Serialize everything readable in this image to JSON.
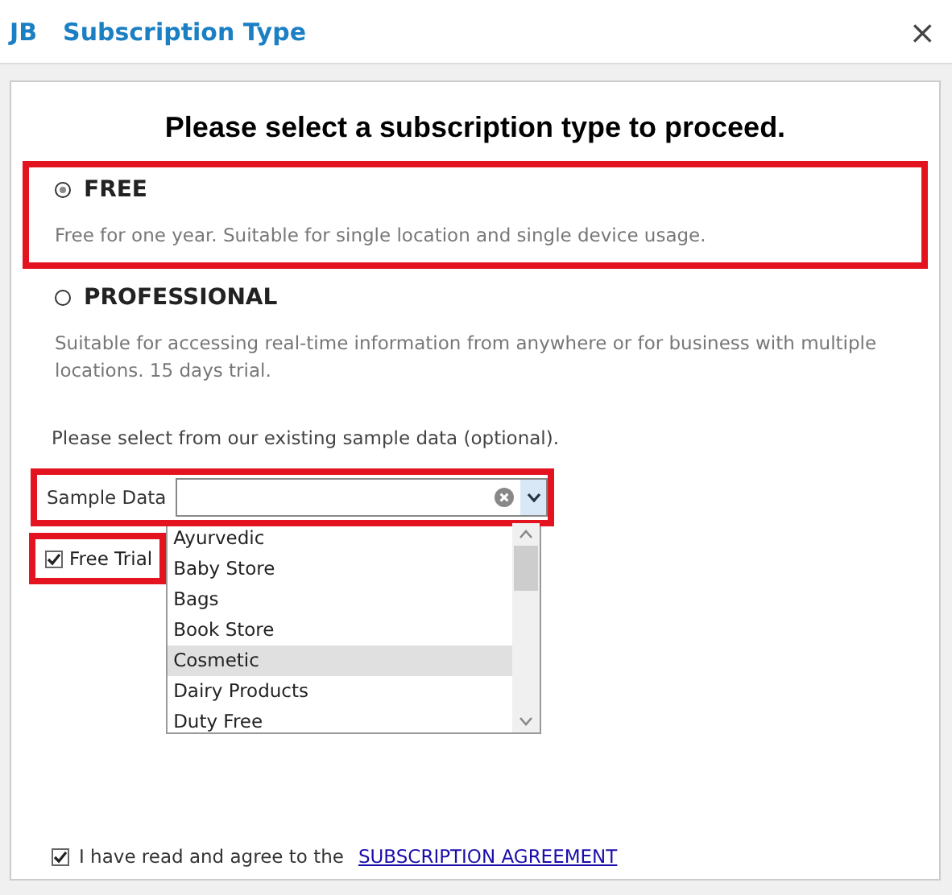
{
  "window": {
    "logo": "JB",
    "title": "Subscription Type",
    "close": "×"
  },
  "heading": "Please select a subscription type to proceed.",
  "plans": [
    {
      "name": "FREE",
      "description": "Free for one year. Suitable for single location and single device usage.",
      "selected": true,
      "highlighted": true
    },
    {
      "name": "PROFESSIONAL",
      "description": "Suitable for accessing real-time information from anywhere or for business with multiple locations. 15 days trial.",
      "selected": false,
      "highlighted": false
    }
  ],
  "sample_prompt": "Please select from our existing sample data (optional).",
  "sample_data": {
    "label": "Sample Data",
    "highlighted": true,
    "expanded": true,
    "options": [
      {
        "label": "Ayurvedic",
        "selected": false
      },
      {
        "label": "Baby Store",
        "selected": false
      },
      {
        "label": "Bags",
        "selected": false
      },
      {
        "label": "Book Store",
        "selected": false
      },
      {
        "label": "Cosmetic",
        "selected": true
      },
      {
        "label": "Dairy Products",
        "selected": false
      },
      {
        "label": "Duty Free",
        "selected": false
      }
    ]
  },
  "free_trial": {
    "label": "Free Trial",
    "checked": true,
    "highlighted": true
  },
  "agreement": {
    "text": "I have read and agree to the",
    "link": "SUBSCRIPTION AGREEMENT",
    "checked": true
  }
}
